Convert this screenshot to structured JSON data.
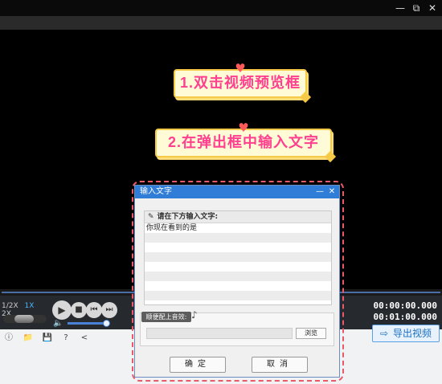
{
  "window": {
    "minimize_glyph": "—",
    "restore_glyph": "⧉",
    "close_glyph": "✕"
  },
  "callouts": [
    {
      "text": "1.双击视频预览框",
      "heart": "♥"
    },
    {
      "text": "2.在弹出框中输入文字",
      "heart": "♥"
    }
  ],
  "player": {
    "speeds": [
      "1/2X",
      "1X",
      "2X"
    ],
    "active_speed": "1X",
    "time_current": "00:00:00.000",
    "time_total": "00:01:00.000",
    "volume_fraction": 0.92,
    "buttons": {
      "play": "▶",
      "stop": "■",
      "prev": "⏮",
      "next": "⏭",
      "volume": "🔈"
    }
  },
  "toolbar": {
    "icons": [
      "info-icon",
      "folder-icon",
      "save-icon",
      "help-icon",
      "share-icon"
    ],
    "glyphs": [
      "ⓘ",
      "📁",
      "💾",
      "?",
      "<"
    ]
  },
  "export_button": {
    "label": "导出视频",
    "icon": "⇨"
  },
  "dialog": {
    "title": "输入文字",
    "minimize": "—",
    "close": "✕",
    "input_heading": "请在下方输入文字:",
    "input_pen": "✎",
    "text_value": "你现在看到的是",
    "music_label": "顺便配上音效:",
    "music_note": "♪",
    "browse_label": "浏览",
    "confirm_label": "确定",
    "cancel_label": "取消"
  },
  "colors": {
    "accent_blue": "#2f7dd6",
    "callout_text": "#ff3f8f",
    "callout_border": "#f7c948",
    "highlight_dash": "#e85a66"
  }
}
